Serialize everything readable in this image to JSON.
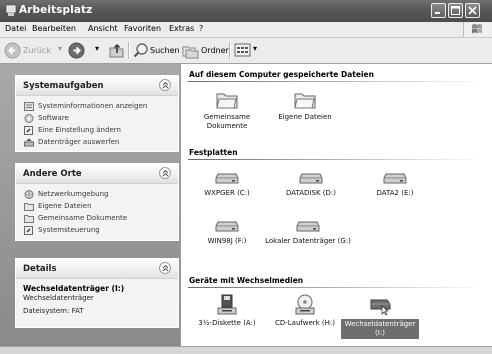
{
  "window": {
    "title": "Arbeitsplatz"
  },
  "menu": [
    "Datei",
    "Bearbeiten",
    "Ansicht",
    "Favoriten",
    "Extras",
    "?"
  ],
  "toolbar": {
    "back": "Zurück",
    "search": "Suchen",
    "folders": "Ordner"
  },
  "sidebar": {
    "systemaufgaben": {
      "title": "Systemaufgaben",
      "items": [
        "Systeminformationen anzeigen",
        "Software",
        "Eine Einstellung ändern",
        "Datenträger auswerfen"
      ]
    },
    "andere_orte": {
      "title": "Andere Orte",
      "items": [
        "Netzwerkumgebung",
        "Eigene Dateien",
        "Gemeinsame Dokumente",
        "Systemsteuerung"
      ]
    },
    "details": {
      "title": "Details",
      "name": "Wechseldatenträger (I:)",
      "type": "Wechseldatenträger",
      "filesystem": "Dateisystem: FAT"
    }
  },
  "content": {
    "sections": [
      {
        "title": "Auf diesem Computer gespeicherte Dateien",
        "items": [
          "Gemeinsame Dokumente",
          "Eigene Dateien"
        ]
      },
      {
        "title": "Festplatten",
        "items": [
          "WXPGER (C:)",
          "DATADISK (D:)",
          "DATA2 (E:)",
          "WIN98J (F:)",
          "Lokaler Datenträger (G:)"
        ]
      },
      {
        "title": "Geräte mit Wechselmedien",
        "items": [
          "3½-Diskette (A:)",
          "CD-Laufwerk (H:)",
          "Wechseldatenträger (I:)"
        ]
      }
    ]
  }
}
